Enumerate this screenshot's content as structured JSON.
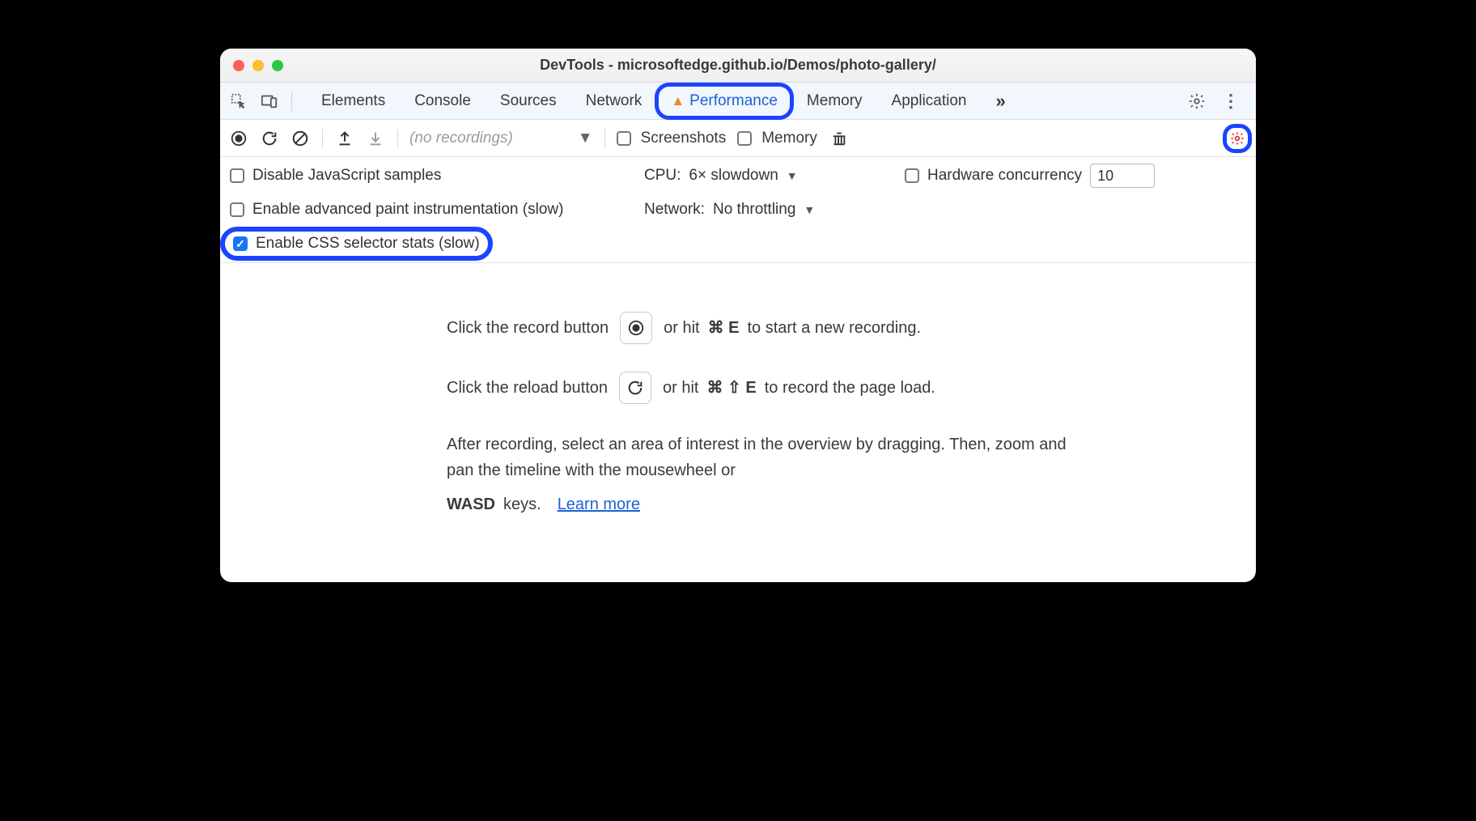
{
  "window": {
    "title": "DevTools - microsoftedge.github.io/Demos/photo-gallery/"
  },
  "tabs": {
    "items": [
      "Elements",
      "Console",
      "Sources",
      "Network",
      "Performance",
      "Memory",
      "Application"
    ],
    "active": "Performance"
  },
  "toolbar": {
    "recordings_placeholder": "(no recordings)",
    "screenshots_label": "Screenshots",
    "memory_label": "Memory"
  },
  "settings": {
    "disable_js_label": "Disable JavaScript samples",
    "disable_js_checked": false,
    "enable_paint_label": "Enable advanced paint instrumentation (slow)",
    "enable_paint_checked": false,
    "enable_css_label": "Enable CSS selector stats (slow)",
    "enable_css_checked": true,
    "cpu_label": "CPU:",
    "cpu_value": "6× slowdown",
    "network_label": "Network:",
    "network_value": "No throttling",
    "hardware_label": "Hardware concurrency",
    "hardware_checked": false,
    "hardware_value": "10"
  },
  "empty": {
    "line1_a": "Click the record button",
    "line1_b": "or hit",
    "line1_key": "⌘ E",
    "line1_c": "to start a new recording.",
    "line2_a": "Click the reload button",
    "line2_b": "or hit",
    "line2_key": "⌘ ⇧ E",
    "line2_c": "to record the page load.",
    "body": "After recording, select an area of interest in the overview by dragging. Then, zoom and pan the timeline with the mousewheel or",
    "body_kbd": "WASD",
    "body_tail": "keys.",
    "learn_more": "Learn more"
  }
}
